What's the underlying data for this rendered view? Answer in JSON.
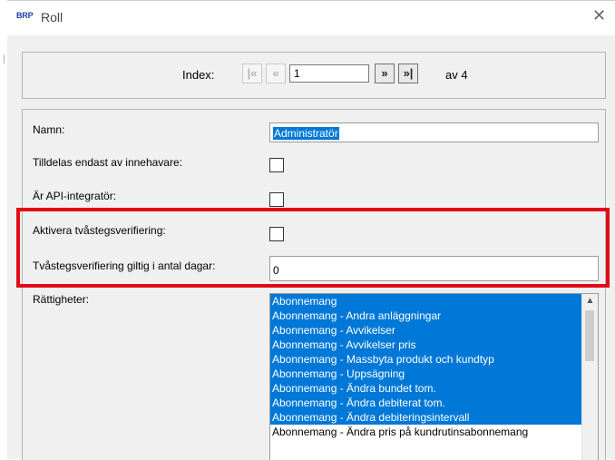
{
  "window": {
    "logo_text": "BRP",
    "title": "Roll",
    "close_glyph": "✕"
  },
  "navigation": {
    "index_label": "Index:",
    "first_glyph": "|«",
    "prev_glyph": "«",
    "current_index": "1",
    "next_glyph": "»",
    "last_glyph": "»|",
    "total_label": "av 4"
  },
  "form": {
    "name_label": "Namn:",
    "name_value": "Administratör",
    "owner_only_label": "Tilldelas endast av innehavare:",
    "owner_only_checked": false,
    "api_integrator_label": "Är API-integratör:",
    "api_integrator_checked": false,
    "two_factor_label": "Aktivera tvåstegsverifiering:",
    "two_factor_checked": false,
    "two_factor_days_label": "Tvåstegsverifiering giltig i antal dagar:",
    "two_factor_days_value": "0",
    "permissions_label": "Rättigheter:"
  },
  "permissions": [
    {
      "label": "Abonnemang",
      "selected": true
    },
    {
      "label": "Abonnemang - Andra anläggningar",
      "selected": true
    },
    {
      "label": "Abonnemang - Avvikelser",
      "selected": true
    },
    {
      "label": "Abonnemang - Avvikelser pris",
      "selected": true
    },
    {
      "label": "Abonnemang - Massbyta produkt och kundtyp",
      "selected": true
    },
    {
      "label": "Abonnemang - Uppsägning",
      "selected": true
    },
    {
      "label": "Abonnemang - Ändra bundet tom.",
      "selected": true
    },
    {
      "label": "Abonnemang - Ändra debiterat tom.",
      "selected": true
    },
    {
      "label": "Abonnemang - Ändra debiteringsintervall",
      "selected": true
    },
    {
      "label": "Abonnemang - Ändra pris på kundrutinsabonnemang",
      "selected": false
    }
  ],
  "colors": {
    "selection": "#0078d7",
    "highlight_border": "#e30a17",
    "logo": "#1f3ea6"
  }
}
